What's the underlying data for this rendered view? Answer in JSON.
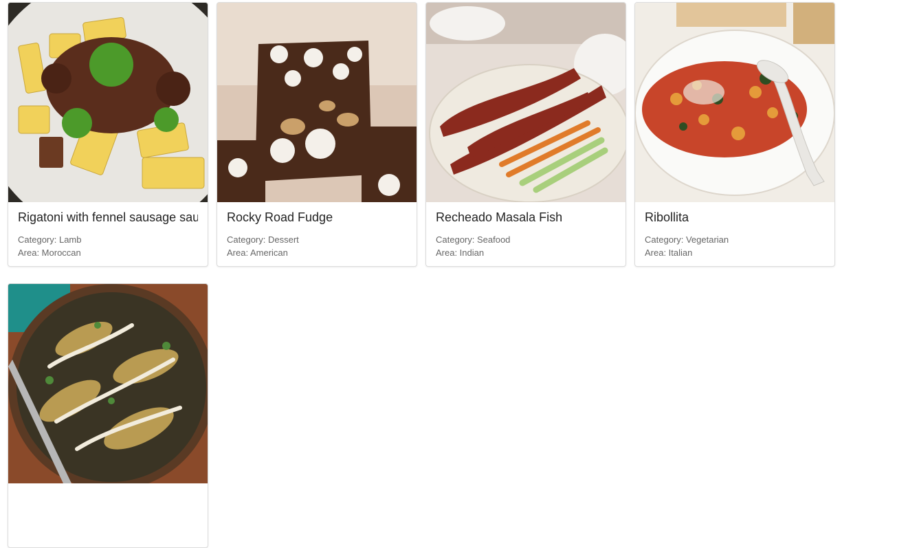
{
  "recipes": [
    {
      "title": "Rigatoni with fennel sausage sauce",
      "category": "Category: Lamb",
      "area": "Area: Moroccan"
    },
    {
      "title": "Rocky Road Fudge",
      "category": "Category: Dessert",
      "area": "Area: American"
    },
    {
      "title": "Recheado Masala Fish",
      "category": "Category: Seafood",
      "area": "Area: Indian"
    },
    {
      "title": "Ribollita",
      "category": "Category: Vegetarian",
      "area": "Area: Italian"
    },
    {
      "title": "",
      "category": "",
      "area": ""
    }
  ]
}
